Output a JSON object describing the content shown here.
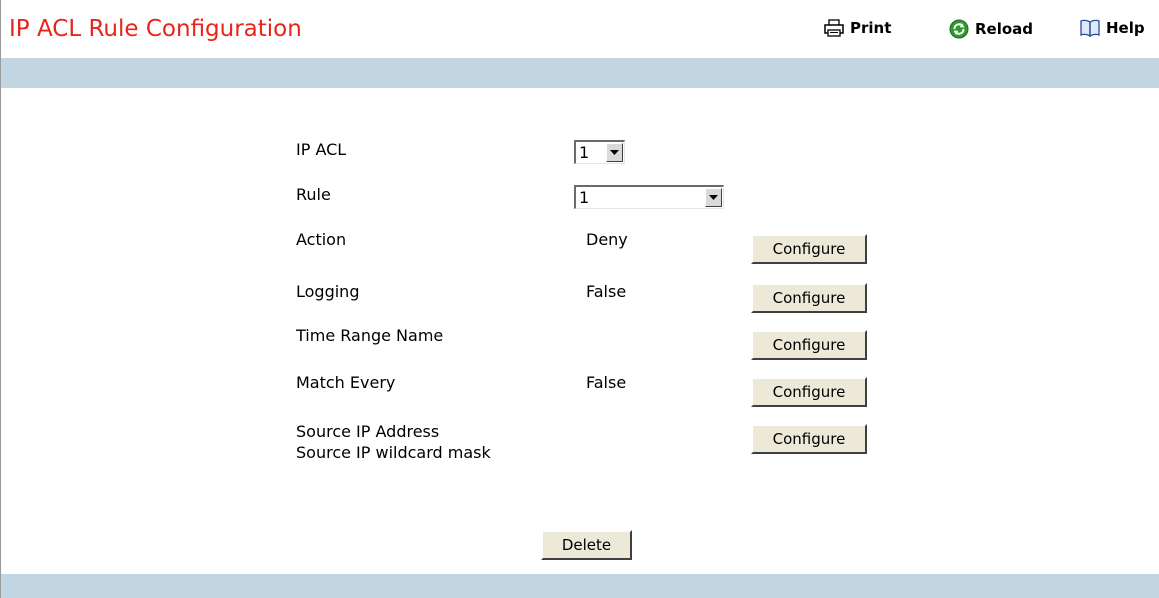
{
  "header": {
    "title": "IP ACL Rule Configuration",
    "print_label": "Print",
    "reload_label": "Reload",
    "help_label": "Help"
  },
  "form": {
    "ip_acl": {
      "label": "IP ACL",
      "selected": "1"
    },
    "rule": {
      "label": "Rule",
      "selected": "1"
    },
    "rows": [
      {
        "label": "Action",
        "value": "Deny",
        "button": "Configure"
      },
      {
        "label": "Logging",
        "value": "False",
        "button": "Configure"
      },
      {
        "label": "Time Range Name",
        "value": "",
        "button": "Configure"
      },
      {
        "label": "Match Every",
        "value": "False",
        "button": "Configure"
      },
      {
        "label": "Source IP Address",
        "label2": "Source IP wildcard mask",
        "value": "",
        "button": "Configure"
      }
    ],
    "delete_label": "Delete"
  },
  "colors": {
    "title": "#e8251a",
    "band": "#c2d6e2",
    "button_face": "#ece9d8"
  },
  "icons": {
    "print": "printer-icon",
    "reload": "reload-icon",
    "help": "help-book-icon"
  }
}
